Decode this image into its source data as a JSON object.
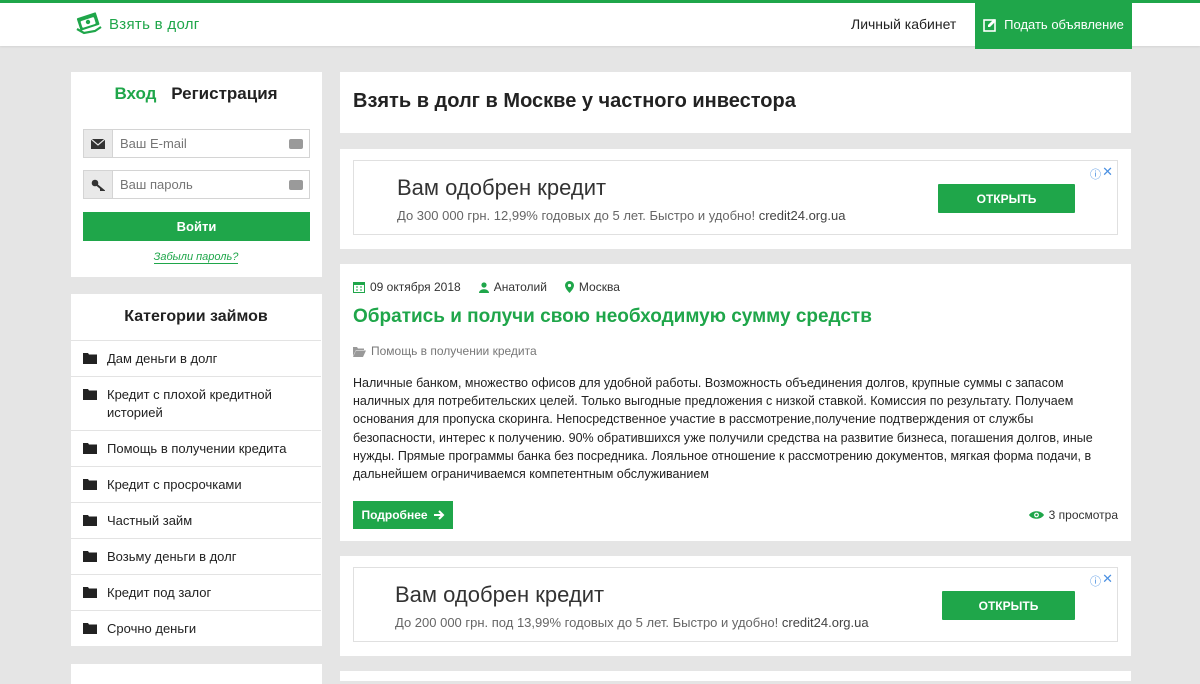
{
  "header": {
    "logo_text": "Взять в долг",
    "cabinet_link": "Личный кабинет",
    "post_button": "Подать объявление"
  },
  "login": {
    "tab_login": "Вход",
    "tab_register": "Регистрация",
    "email_placeholder": "Ваш E-mail",
    "password_placeholder": "Ваш пароль",
    "submit": "Войти",
    "forgot": "Забыли пароль?"
  },
  "categories": {
    "title": "Категории займов",
    "items": [
      "Дам деньги в долг",
      "Кредит с плохой кредитной историей",
      "Помощь в получении кредита",
      "Кредит с просрочками",
      "Частный займ",
      "Возьму деньги в долг",
      "Кредит под залог",
      "Срочно деньги"
    ]
  },
  "main": {
    "page_title": "Взять в долг в Москве у частного инвестора",
    "ads": [
      {
        "title": "Вам одобрен кредит",
        "text": "До 300 000 грн. 12,99% годовых до 5 лет. Быстро и удобно!",
        "domain": "credit24.org.ua",
        "button": "ОТКРЫТЬ"
      },
      {
        "title": "Вам одобрен кредит",
        "text": "До 200 000 грн. под 13,99% годовых до 5 лет. Быстро и удобно!",
        "domain": "credit24.org.ua",
        "button": "ОТКРЫТЬ"
      }
    ],
    "ad_info_icon": "ⓘ",
    "ad_close_icon": "✕",
    "post": {
      "date": "09 октября 2018",
      "author": "Анатолий",
      "city": "Москва",
      "title": "Обратись и получи свою необходимую сумму средств",
      "category": "Помощь в получении кредита",
      "body": "Наличные банком, множество офисов для удобной работы. Возможность объединения долгов, крупные суммы с запасом наличных для потребительских целей. Только выгодные предложения с низкой ставкой. Комиссия по результату. Получаем основания для пропуска скоринга. Непосредственное участие в рассмотрение,получение подтверждения от службы безопасности, интерес к получению. 90% обратившихся уже получили средства на развитие бизнеса, погашения долгов, иные нужды. Прямые программы банка без посредника. Лояльное отношение к рассмотрению документов, мягкая форма подачи, в дальнейшем ограничиваемся компетентным обслуживанием",
      "more_button": "Подробнее",
      "views": "3 просмотра"
    }
  },
  "colors": {
    "accent": "#1fa64a",
    "background": "#e5e5e5"
  }
}
